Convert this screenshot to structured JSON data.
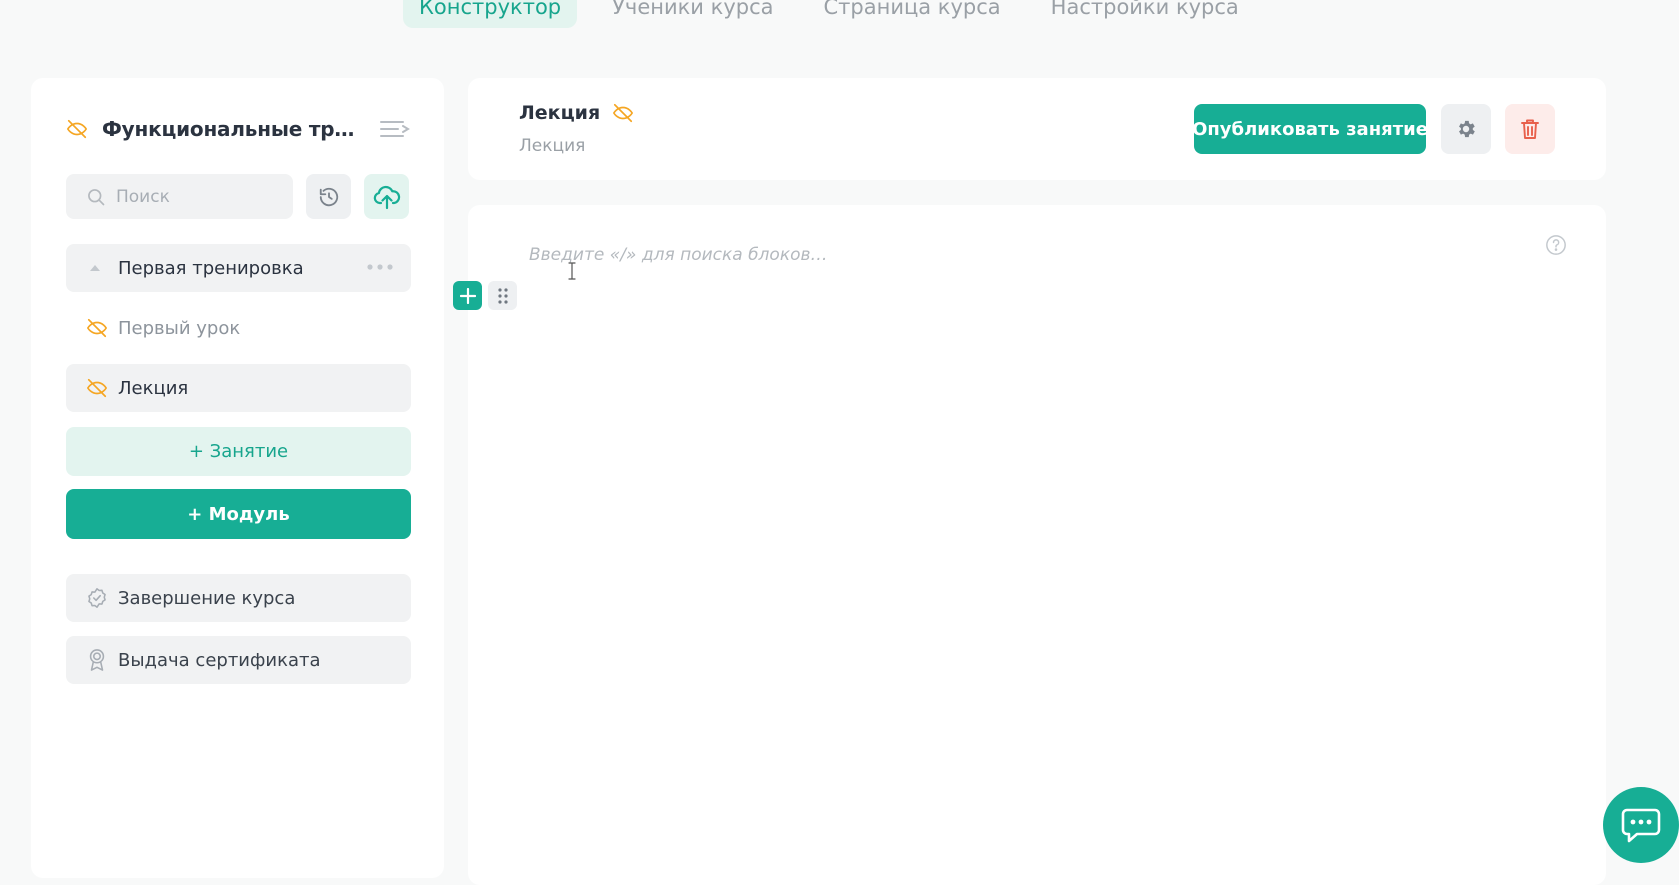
{
  "tabs": [
    {
      "label": "Конструктор",
      "active": true
    },
    {
      "label": "Ученики курса",
      "active": false
    },
    {
      "label": "Страница курса",
      "active": false
    },
    {
      "label": "Настройки курса",
      "active": false
    }
  ],
  "sidebar": {
    "course_title": "Функциональные трени...",
    "search_placeholder": "Поиск",
    "module": {
      "label": "Первая тренировка"
    },
    "lessons": [
      {
        "label": "Первый урок",
        "hidden": true
      },
      {
        "label": "Лекция",
        "hidden": true,
        "selected": true
      }
    ],
    "add_lesson_label": "+ Занятие",
    "add_module_label": "+ Модуль",
    "finish_label": "Завершение курса",
    "certificate_label": "Выдача сертификата"
  },
  "lesson_header": {
    "title": "Лекция",
    "subtitle": "Лекция",
    "publish_label": "Опубликовать занятие"
  },
  "editor": {
    "placeholder": "Введите «/» для поиска блоков…"
  },
  "colors": {
    "accent": "#17ae95",
    "accent_light": "#e3f4ef",
    "hidden_icon": "#f5a623",
    "danger": "#e8604c",
    "danger_light": "#fdecea"
  }
}
